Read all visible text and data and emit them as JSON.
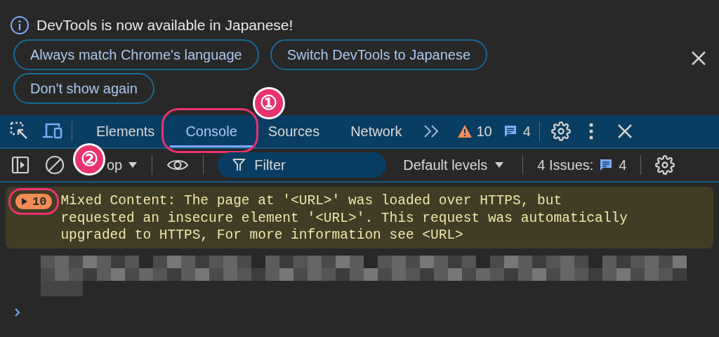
{
  "infobar": {
    "message": "DevTools is now available in Japanese!",
    "buttons": [
      {
        "label": "Always match Chrome's language"
      },
      {
        "label": "Switch DevTools to Japanese"
      },
      {
        "label": "Don't show again"
      }
    ]
  },
  "tabs": [
    {
      "label": "Elements",
      "selected": false
    },
    {
      "label": "Console",
      "selected": true,
      "callout": "①"
    },
    {
      "label": "Sources",
      "selected": false
    },
    {
      "label": "Network",
      "selected": false
    }
  ],
  "counters": {
    "warnings": "10",
    "messages": "4"
  },
  "toolbar": {
    "context": "op",
    "context_callout": "②",
    "filter_placeholder": "Filter",
    "levels": "Default levels",
    "issues_label": "4 Issues:",
    "issues_count": "4"
  },
  "messages": [
    {
      "count": "10",
      "circled": true,
      "text": "Mixed Content: The page at '<URL>' was loaded over HTTPS, but requested an insecure element '<URL>'. This request was automatically upgraded to HTTPS, For more information see <URL>"
    }
  ]
}
